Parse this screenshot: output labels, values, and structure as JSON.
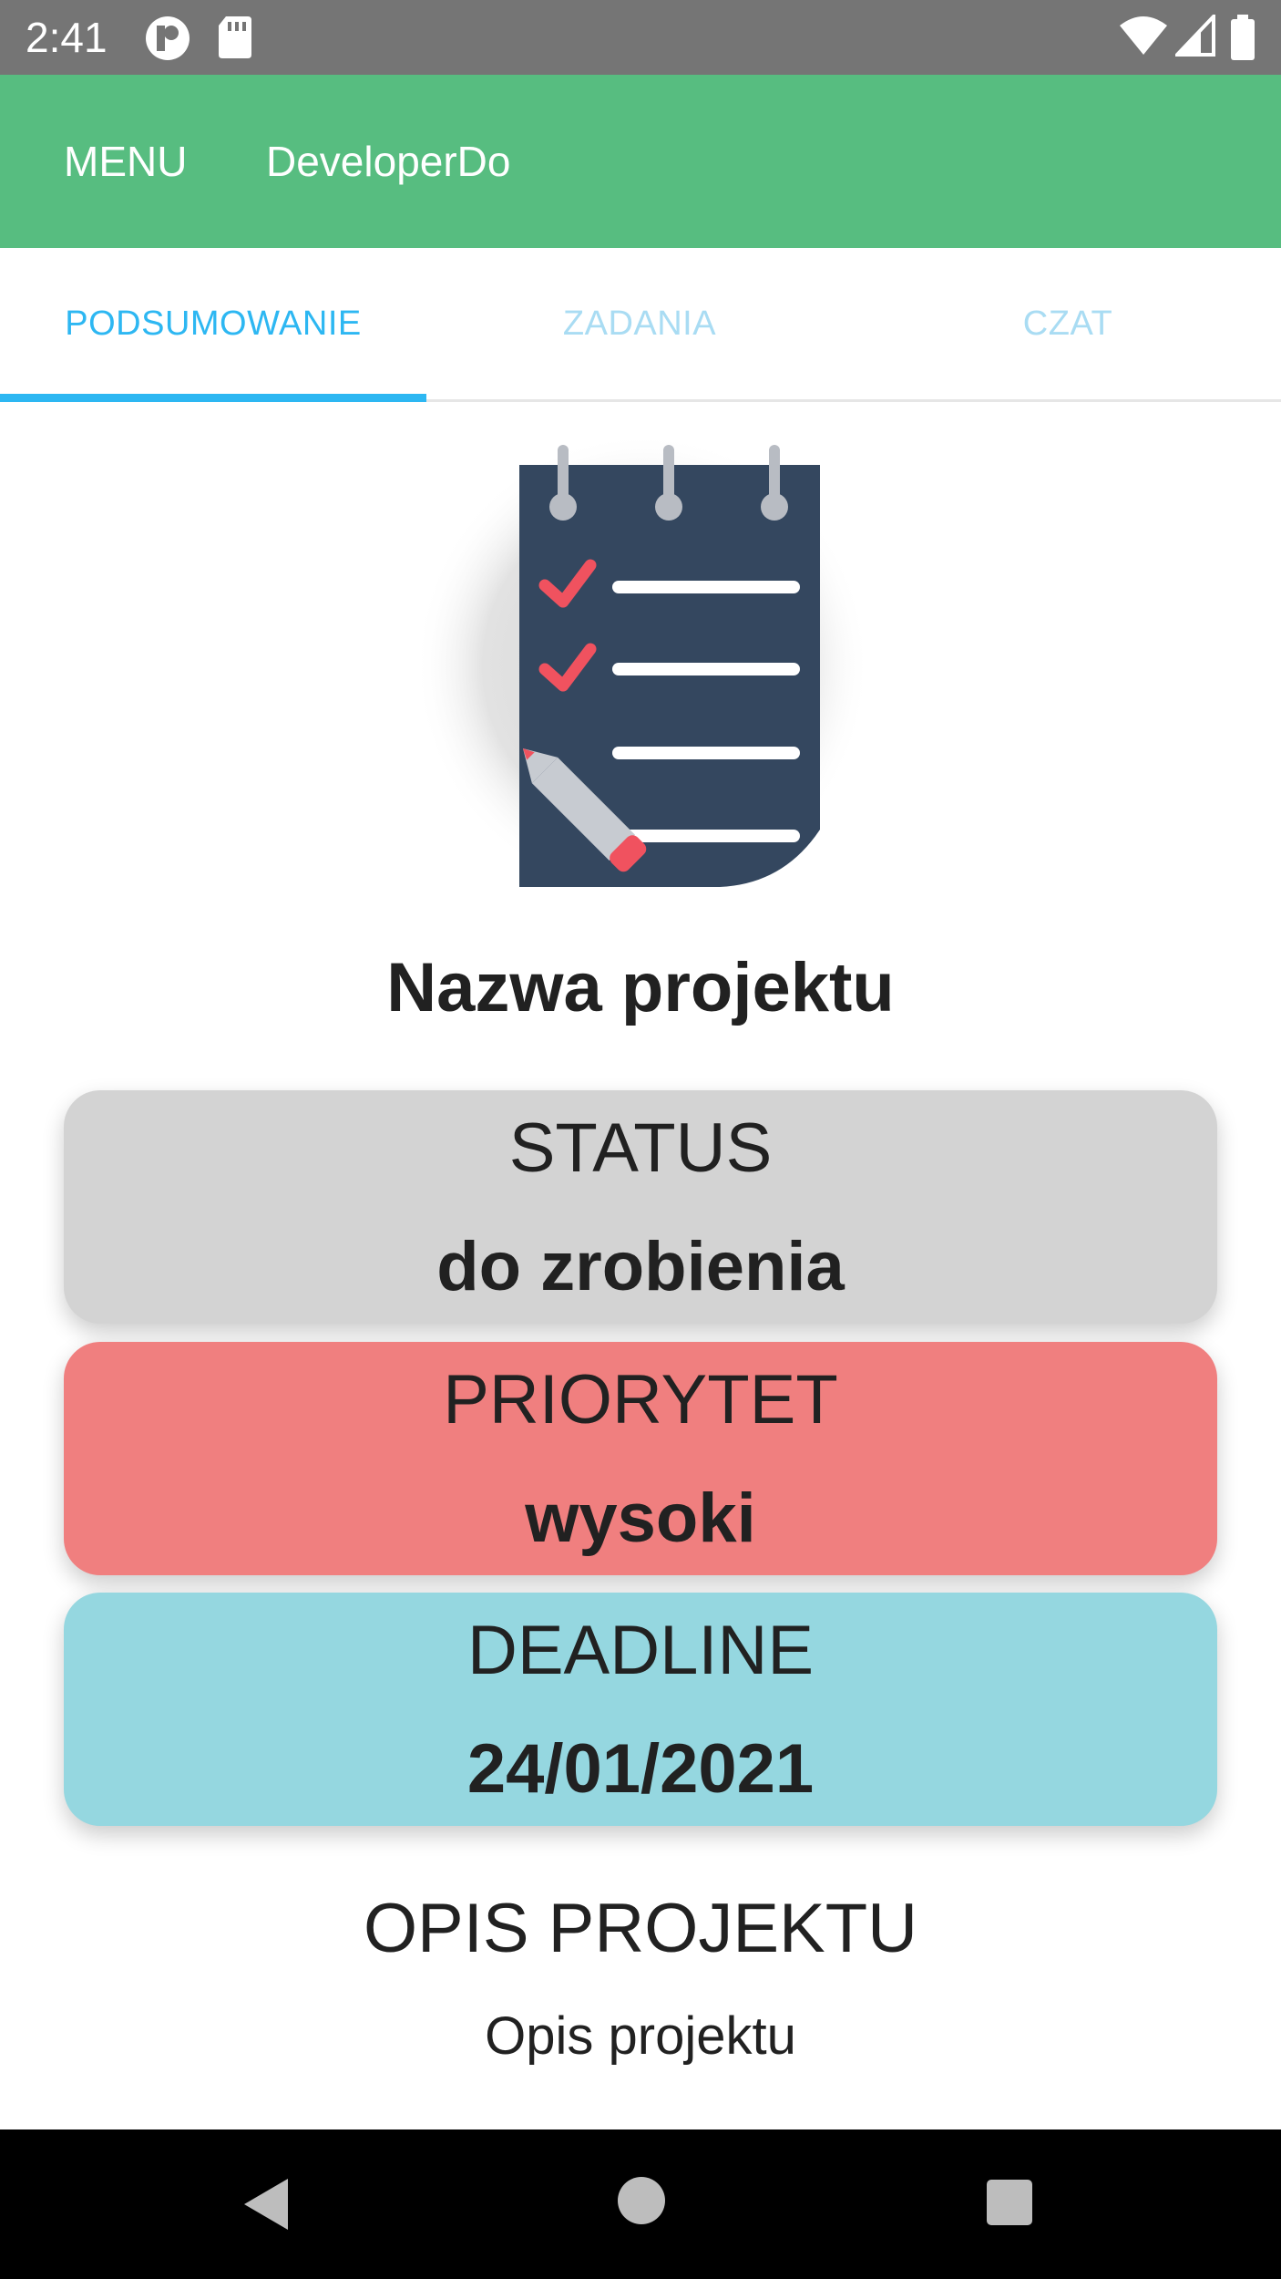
{
  "status_bar": {
    "time": "2:41",
    "icons": [
      "app-notification-icon",
      "sd-card-icon",
      "wifi-icon",
      "cell-signal-icon",
      "battery-icon"
    ]
  },
  "app_bar": {
    "menu_label": "MENU",
    "title": "DeveloperDo",
    "color": "#57bd80"
  },
  "tabs": [
    {
      "label": "PODSUMOWANIE",
      "active": true
    },
    {
      "label": "ZADANIA",
      "active": false
    },
    {
      "label": "CZAT",
      "active": false
    }
  ],
  "colors": {
    "tab_active": "#2db7f2",
    "tab_inactive": "#a9dcf3",
    "status_card": "#d3d3d3",
    "priority_card": "#f07f7f",
    "deadline_card": "#95d7e0"
  },
  "project": {
    "image_icon": "checklist-icon",
    "name": "Nazwa projektu",
    "status": {
      "label": "STATUS",
      "value": "do zrobienia"
    },
    "priority": {
      "label": "PRIORYTET",
      "value": "wysoki"
    },
    "deadline": {
      "label": "DEADLINE",
      "value": "24/01/2021"
    },
    "description_heading": "OPIS PROJEKTU",
    "description": "Opis projektu"
  },
  "nav_bar": {
    "icons": [
      "back-icon",
      "home-icon",
      "recents-icon"
    ]
  }
}
